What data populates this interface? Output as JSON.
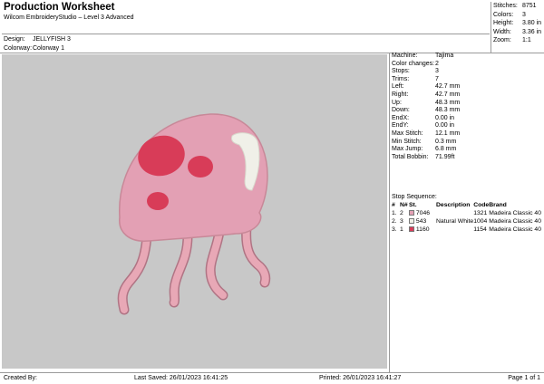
{
  "header": {
    "title": "Production Worksheet",
    "software": "Wilcom EmbroideryStudio – Level 3 Advanced",
    "design_label": "Design:",
    "design_value": "JELLYFISH 3",
    "colorway_label": "Colorway:",
    "colorway_value": "Colorway 1"
  },
  "stats": [
    {
      "label": "Stitches:",
      "value": "8751"
    },
    {
      "label": "Colors:",
      "value": "3"
    },
    {
      "label": "Height:",
      "value": "3.80 in"
    },
    {
      "label": "Width:",
      "value": "3.36 in"
    },
    {
      "label": "Zoom:",
      "value": "1:1"
    }
  ],
  "properties": [
    {
      "label": "Machine:",
      "value": "Tajima"
    },
    {
      "label": "Color changes:",
      "value": "2"
    },
    {
      "label": "Stops:",
      "value": "3"
    },
    {
      "label": "Trims:",
      "value": "7"
    },
    {
      "label": "Left:",
      "value": "42.7 mm"
    },
    {
      "label": "Right:",
      "value": "42.7 mm"
    },
    {
      "label": "Up:",
      "value": "48.3 mm"
    },
    {
      "label": "Down:",
      "value": "48.3 mm"
    },
    {
      "label": "EndX:",
      "value": "0.00 in"
    },
    {
      "label": "EndY:",
      "value": "0.00 in"
    },
    {
      "label": "Max Stitch:",
      "value": "12.1 mm"
    },
    {
      "label": "Min Stitch:",
      "value": "0.3 mm"
    },
    {
      "label": "Max Jump:",
      "value": "6.8 mm"
    },
    {
      "label": "Total Bobbin:",
      "value": "71.99ft"
    }
  ],
  "stop_sequence": {
    "title": "Stop Sequence:",
    "headers": {
      "seq": "#",
      "n": "N#",
      "st": "St.",
      "description": "Description",
      "code": "Code",
      "brand": "Brand"
    },
    "rows": [
      {
        "seq": "1.",
        "n": "2",
        "color": "#e3a0b4",
        "st": "7046",
        "description": "",
        "code": "1321",
        "brand": "Madeira Classic 40"
      },
      {
        "seq": "2.",
        "n": "3",
        "color": "#f0f0e8",
        "st": "543",
        "description": "Natural White",
        "code": "1004",
        "brand": "Madeira Classic 40"
      },
      {
        "seq": "3.",
        "n": "1",
        "color": "#d83c58",
        "st": "1160",
        "description": "",
        "code": "1154",
        "brand": "Madeira Classic 40"
      }
    ]
  },
  "footer": {
    "created_by": "Created By:",
    "last_saved": "Last Saved: 26/01/2023 16:41:25",
    "printed": "Printed: 26/01/2023 16:41:27",
    "page": "Page 1 of 1"
  },
  "colors": {
    "canvas_bg": "#c8c8c8",
    "body_pink": "#e3a0b4",
    "spot_red": "#d83c58",
    "highlight_white": "#f0f0e8",
    "tentacle_pink": "#e8a8b6"
  }
}
